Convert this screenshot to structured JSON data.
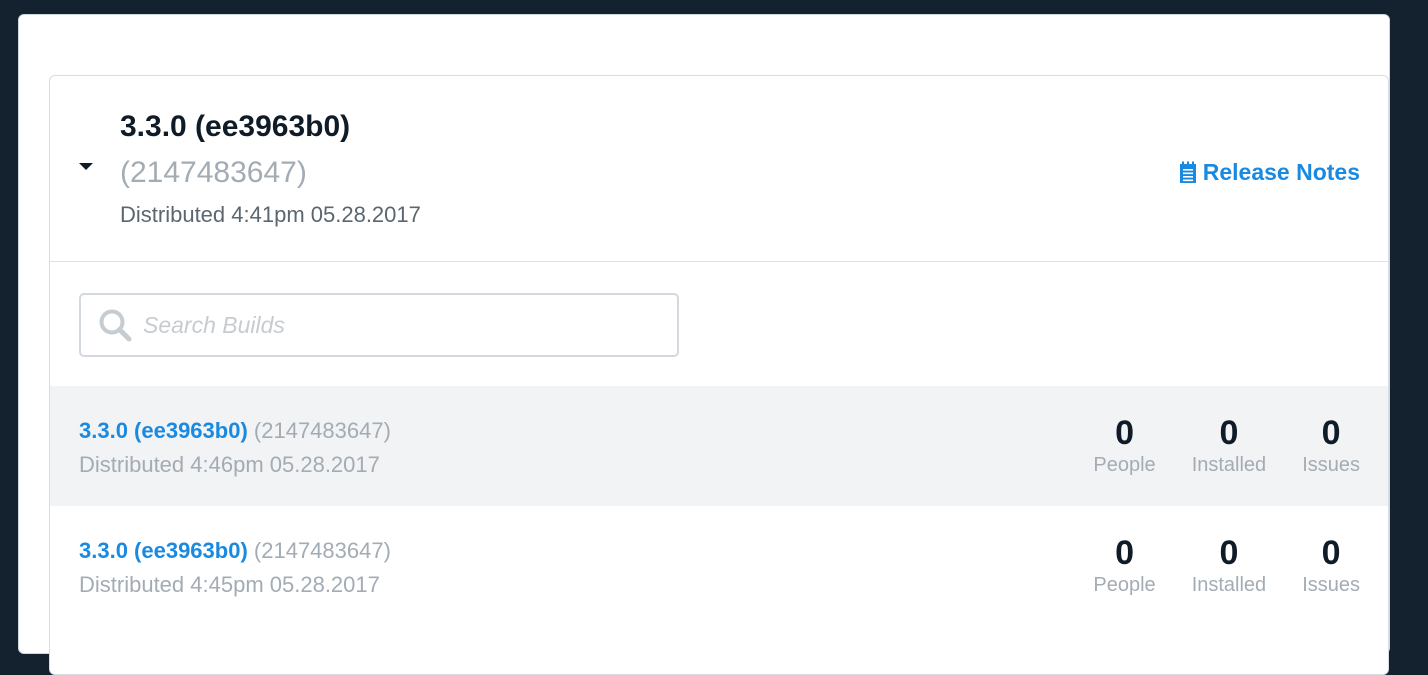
{
  "header": {
    "title": "3.3.0 (ee3963b0)",
    "build_number": "(2147483647)",
    "distributed": "Distributed 4:41pm 05.28.2017",
    "release_notes_label": "Release Notes"
  },
  "search": {
    "placeholder": "Search Builds",
    "value": ""
  },
  "builds": [
    {
      "version": "3.3.0 (ee3963b0)",
      "build_number": "(2147483647)",
      "distributed": "Distributed 4:46pm 05.28.2017",
      "people": "0",
      "people_label": "People",
      "installed": "0",
      "installed_label": "Installed",
      "issues": "0",
      "issues_label": "Issues"
    },
    {
      "version": "3.3.0 (ee3963b0)",
      "build_number": "(2147483647)",
      "distributed": "Distributed 4:45pm 05.28.2017",
      "people": "0",
      "people_label": "People",
      "installed": "0",
      "installed_label": "Installed",
      "issues": "0",
      "issues_label": "Issues"
    }
  ],
  "colors": {
    "background": "#14222f",
    "accent": "#1a8ae0",
    "text_dark": "#0f1b27",
    "text_muted": "#a3acb4",
    "row_alt": "#f2f3f5"
  },
  "icons": {
    "collapse": "caret-down-icon",
    "release_notes": "notes-icon",
    "search": "search-icon"
  }
}
